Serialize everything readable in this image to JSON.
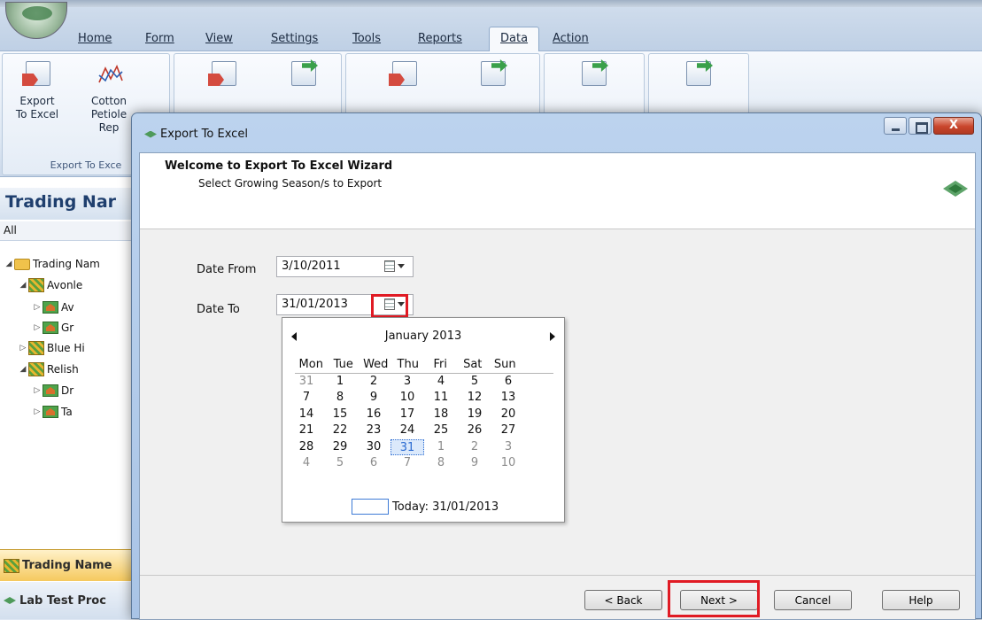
{
  "ribbon": {
    "tabs": [
      "Home",
      "Form",
      "View",
      "Settings",
      "Tools",
      "Reports",
      "Data",
      "Action"
    ],
    "active_tab": "Data",
    "buttons": [
      {
        "label": "Export To Excel",
        "icon": "export-excel-icon"
      },
      {
        "label": "Cotton Petiole Rep",
        "icon": "chart-line-icon"
      }
    ],
    "group_label": "Export To Exce"
  },
  "sidebar": {
    "header": "Trading Nar",
    "filter": "All",
    "tree": [
      {
        "label": "Trading Nam",
        "level": 0,
        "expander": "◢",
        "icon": "folder-icon"
      },
      {
        "label": "Avonle",
        "level": 1,
        "expander": "◢",
        "icon": "trading-name-icon"
      },
      {
        "label": "Av",
        "level": 2,
        "expander": "▷",
        "icon": "farm-icon"
      },
      {
        "label": "Gr",
        "level": 2,
        "expander": "▷",
        "icon": "farm-icon"
      },
      {
        "label": "Blue Hi",
        "level": 1,
        "expander": "▷",
        "icon": "trading-name-icon"
      },
      {
        "label": "Relish",
        "level": 1,
        "expander": "◢",
        "icon": "trading-name-icon"
      },
      {
        "label": "Dr",
        "level": 2,
        "expander": "▷",
        "icon": "farm-icon"
      },
      {
        "label": "Ta",
        "level": 2,
        "expander": "▷",
        "icon": "farm-icon"
      }
    ],
    "bottom_nav": [
      "Trading Name",
      "Lab Test Proc"
    ]
  },
  "dialog": {
    "title": "Export To Excel",
    "close_label": "X",
    "header_title": "Welcome to Export To Excel Wizard",
    "header_subtitle": "Select Growing Season/s to Export",
    "date_from_label": "Date From",
    "date_from_value": "3/10/2011",
    "date_to_label": "Date To",
    "date_to_value": "31/01/2013",
    "calendar": {
      "month": "January 2013",
      "weekdays": [
        "Mon",
        "Tue",
        "Wed",
        "Thu",
        "Fri",
        "Sat",
        "Sun"
      ],
      "weeks": [
        [
          "31",
          "1",
          "2",
          "3",
          "4",
          "5",
          "6"
        ],
        [
          "7",
          "8",
          "9",
          "10",
          "11",
          "12",
          "13"
        ],
        [
          "14",
          "15",
          "16",
          "17",
          "18",
          "19",
          "20"
        ],
        [
          "21",
          "22",
          "23",
          "24",
          "25",
          "26",
          "27"
        ],
        [
          "28",
          "29",
          "30",
          "31",
          "1",
          "2",
          "3"
        ],
        [
          "4",
          "5",
          "6",
          "7",
          "8",
          "9",
          "10"
        ]
      ],
      "selected": "31",
      "today_label": "Today: 31/01/2013"
    },
    "buttons": {
      "back": "< Back",
      "next": "Next >",
      "cancel": "Cancel",
      "help": "Help"
    }
  }
}
